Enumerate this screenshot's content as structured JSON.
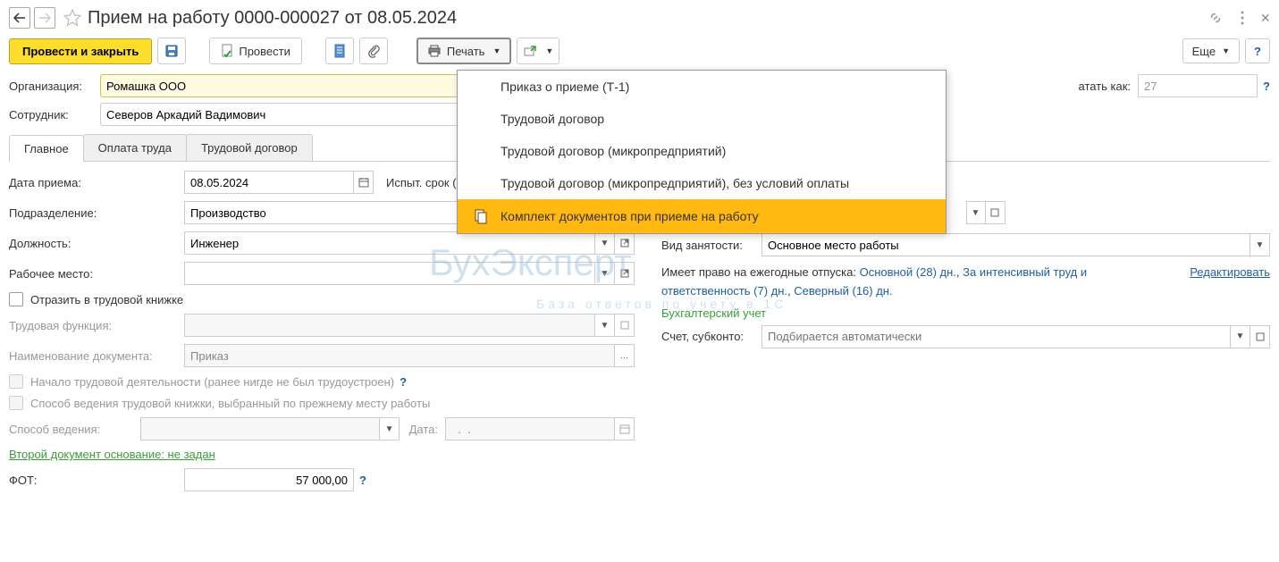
{
  "header": {
    "title": "Прием на работу 0000-000027 от 08.05.2024"
  },
  "toolbar": {
    "post_and_close": "Провести и закрыть",
    "post": "Провести",
    "print": "Печать",
    "more": "Еще"
  },
  "print_menu": {
    "items": [
      "Приказ о приеме (Т-1)",
      "Трудовой договор",
      "Трудовой договор (микропредприятий)",
      "Трудовой договор (микропредприятий), без условий оплаты",
      "Комплект документов при приеме на работу"
    ],
    "highlighted_index": 4
  },
  "top_fields": {
    "org_label": "Организация:",
    "org_value": "Ромашка ООО",
    "emp_label": "Сотрудник:",
    "emp_value": "Северов Аркадий Вадимович",
    "print_as_label": "атать как:",
    "print_as_value": "27"
  },
  "tabs": {
    "items": [
      "Главное",
      "Оплата труда",
      "Трудовой договор"
    ],
    "active": 0
  },
  "left": {
    "date_label": "Дата приема:",
    "date_value": "08.05.2024",
    "trial_label": "Испыт. срок (мес):",
    "dept_label": "Подразделение:",
    "dept_value": "Производство",
    "position_label": "Должность:",
    "position_value": "Инженер",
    "workplace_label": "Рабочее место:",
    "workplace_value": "",
    "reflect_cb": "Отразить в трудовой книжке",
    "func_label": "Трудовая функция:",
    "docname_label": "Наименование документа:",
    "docname_value": "Приказ",
    "start_cb": "Начало трудовой деятельности (ранее нигде не был трудоустроен)",
    "method_cb": "Способ ведения трудовой книжки, выбранный по прежнему месту работы",
    "method_label": "Способ ведения:",
    "date2_label": "Дата:",
    "date2_value": "  .  .",
    "second_doc_link": "Второй документ основание: не задан",
    "fot_label": "ФОТ:",
    "fot_value": "57 000,00"
  },
  "right": {
    "emptype_label": "Вид занятости:",
    "emptype_value": "Основное место работы",
    "vacation_text_pre": "Имеет право на ежегодные отпуска: ",
    "vacation_main": "Основной (28) дн.",
    "vacation_sep1": ", ",
    "vacation_int": "За интенсивный труд и ответственность (7) дн.",
    "vacation_sep2": ", ",
    "vacation_north": "Северный (16) дн.",
    "edit_link": "Редактировать",
    "acct_label": "Бухгалтерский учет",
    "acct_sub_label": "Счет, субконто:",
    "acct_placeholder": "Подбирается автоматически"
  },
  "watermark": {
    "main": "БухЭксперт",
    "sub": "База ответов по учету в 1С"
  }
}
